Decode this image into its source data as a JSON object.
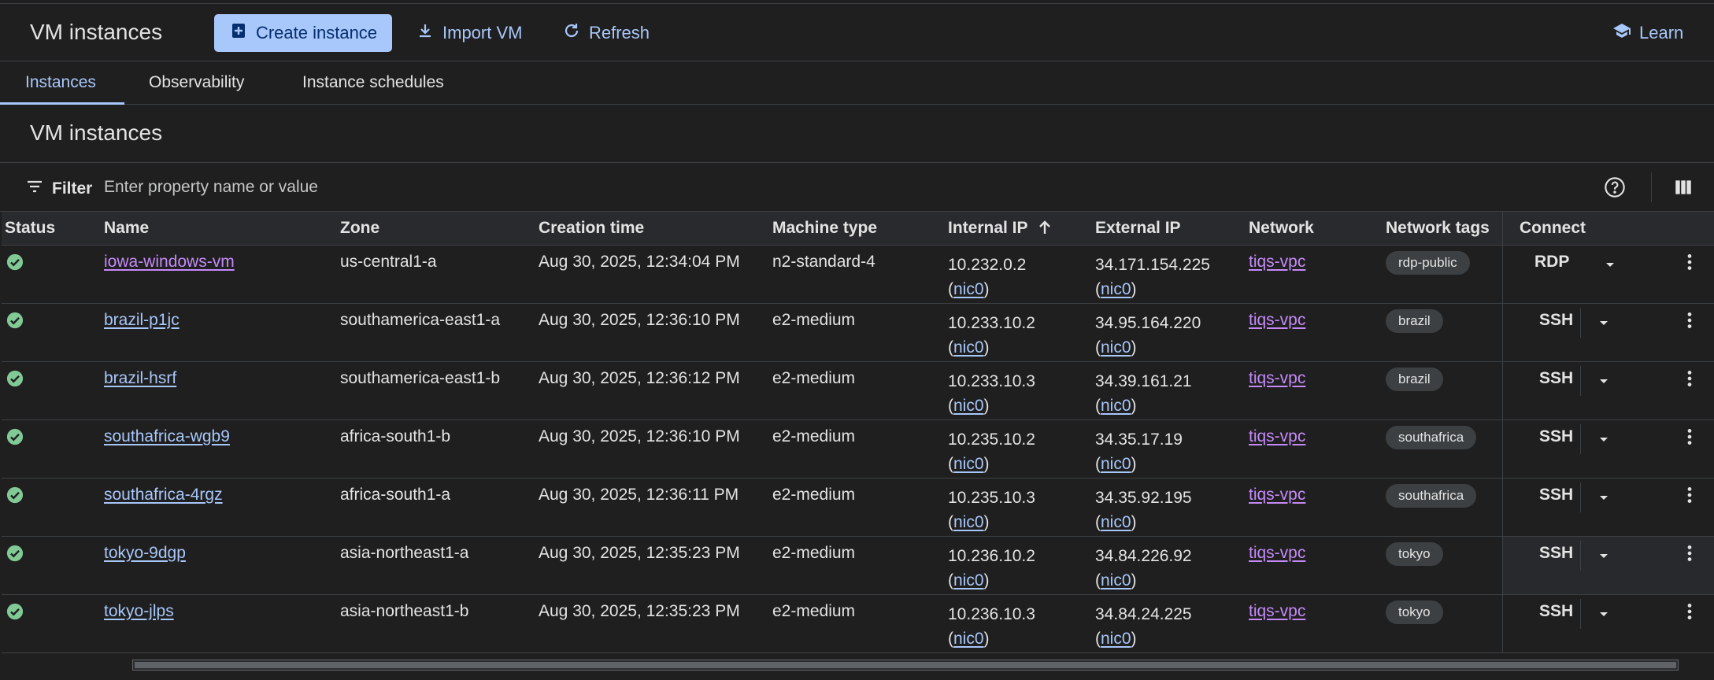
{
  "header": {
    "title": "VM instances",
    "create_label": "Create instance",
    "import_label": "Import VM",
    "refresh_label": "Refresh",
    "learn_label": "Learn"
  },
  "tabs": [
    {
      "label": "Instances",
      "active": true
    },
    {
      "label": "Observability",
      "active": false
    },
    {
      "label": "Instance schedules",
      "active": false
    }
  ],
  "section": {
    "title": "VM instances"
  },
  "filter": {
    "label": "Filter",
    "placeholder": "Enter property name or value"
  },
  "table": {
    "columns": [
      "Status",
      "Name",
      "Zone",
      "Creation time",
      "Machine type",
      "Internal IP",
      "External IP",
      "Network",
      "Network tags",
      "Connect"
    ],
    "sort_column": "Internal IP",
    "sort_direction": "ascending",
    "rows": [
      {
        "status": "running",
        "name": "iowa-windows-vm",
        "name_visited": true,
        "zone": "us-central1-a",
        "created": "Aug 30, 2025, 12:34:04 PM",
        "machine": "n2-standard-4",
        "internal_ip": "10.232.0.2",
        "internal_nic": "nic0",
        "external_ip": "34.171.154.225",
        "external_nic": "nic0",
        "network": "tiqs-vpc",
        "tag": "rdp-public",
        "connect": "RDP"
      },
      {
        "status": "running",
        "name": "brazil-p1jc",
        "name_visited": false,
        "zone": "southamerica-east1-a",
        "created": "Aug 30, 2025, 12:36:10 PM",
        "machine": "e2-medium",
        "internal_ip": "10.233.10.2",
        "internal_nic": "nic0",
        "external_ip": "34.95.164.220",
        "external_nic": "nic0",
        "network": "tiqs-vpc",
        "tag": "brazil",
        "connect": "SSH"
      },
      {
        "status": "running",
        "name": "brazil-hsrf",
        "name_visited": false,
        "zone": "southamerica-east1-b",
        "created": "Aug 30, 2025, 12:36:12 PM",
        "machine": "e2-medium",
        "internal_ip": "10.233.10.3",
        "internal_nic": "nic0",
        "external_ip": "34.39.161.21",
        "external_nic": "nic0",
        "network": "tiqs-vpc",
        "tag": "brazil",
        "connect": "SSH"
      },
      {
        "status": "running",
        "name": "southafrica-wgb9",
        "name_visited": false,
        "zone": "africa-south1-b",
        "created": "Aug 30, 2025, 12:36:10 PM",
        "machine": "e2-medium",
        "internal_ip": "10.235.10.2",
        "internal_nic": "nic0",
        "external_ip": "34.35.17.19",
        "external_nic": "nic0",
        "network": "tiqs-vpc",
        "tag": "southafrica",
        "connect": "SSH"
      },
      {
        "status": "running",
        "name": "southafrica-4rgz",
        "name_visited": false,
        "zone": "africa-south1-a",
        "created": "Aug 30, 2025, 12:36:11 PM",
        "machine": "e2-medium",
        "internal_ip": "10.235.10.3",
        "internal_nic": "nic0",
        "external_ip": "34.35.92.195",
        "external_nic": "nic0",
        "network": "tiqs-vpc",
        "tag": "southafrica",
        "connect": "SSH"
      },
      {
        "status": "running",
        "name": "tokyo-9dgp",
        "name_visited": false,
        "zone": "asia-northeast1-a",
        "created": "Aug 30, 2025, 12:35:23 PM",
        "machine": "e2-medium",
        "internal_ip": "10.236.10.2",
        "internal_nic": "nic0",
        "external_ip": "34.84.226.92",
        "external_nic": "nic0",
        "network": "tiqs-vpc",
        "tag": "tokyo",
        "connect": "SSH"
      },
      {
        "status": "running",
        "name": "tokyo-jlps",
        "name_visited": false,
        "zone": "asia-northeast1-b",
        "created": "Aug 30, 2025, 12:35:23 PM",
        "machine": "e2-medium",
        "internal_ip": "10.236.10.3",
        "internal_nic": "nic0",
        "external_ip": "34.84.24.225",
        "external_nic": "nic0",
        "network": "tiqs-vpc",
        "tag": "tokyo",
        "connect": "SSH"
      }
    ]
  },
  "colors": {
    "background": "#1f1f1f",
    "accent": "#a8c7fa",
    "visited_link": "#c58af9",
    "status_ok": "#81c995",
    "header_row": "#292a2d"
  },
  "icons": {
    "create": "add-box-icon",
    "import": "download-icon",
    "refresh": "refresh-icon",
    "learn": "school-icon",
    "filter": "filter-icon",
    "help": "help-icon",
    "columns": "columns-icon",
    "status": "check-circle-icon",
    "sort": "arrow-up-icon",
    "more": "more-vert-icon",
    "dropdown": "arrow-drop-down-icon"
  }
}
